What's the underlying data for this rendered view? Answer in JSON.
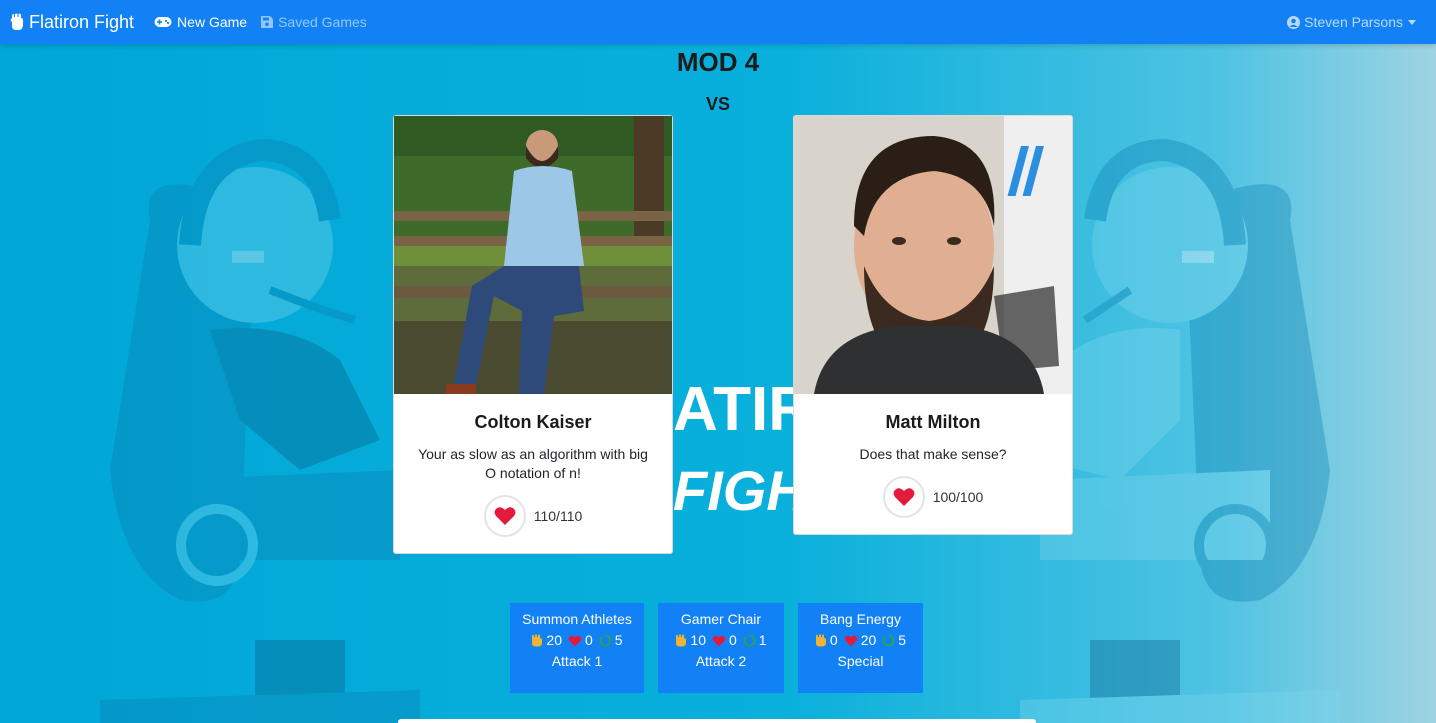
{
  "navbar": {
    "brand": "Flatiron Fight",
    "new_game": "New Game",
    "saved_games": "Saved Games",
    "user": "Steven Parsons"
  },
  "title": "MOD 4",
  "vs": "VS",
  "background_text": [
    "ATIR",
    "FIGHTE"
  ],
  "players": [
    {
      "name": "Colton Kaiser",
      "quote": "Your as slow as an algorithm with big O notation of n!",
      "hp": "110/110"
    },
    {
      "name": "Matt Milton",
      "quote": "Does that make sense?",
      "hp": "100/100"
    }
  ],
  "moves": [
    {
      "name": "Summon Athletes",
      "attack": "20",
      "heal": "0",
      "cooldown": "5",
      "type": "Attack 1"
    },
    {
      "name": "Gamer Chair",
      "attack": "10",
      "heal": "0",
      "cooldown": "1",
      "type": "Attack 2"
    },
    {
      "name": "Bang Energy",
      "attack": "0",
      "heal": "20",
      "cooldown": "5",
      "type": "Special"
    }
  ],
  "colors": {
    "navbar": "#1181f5",
    "heart": "#e21b3c",
    "cooldown": "#28a745",
    "fist": "#f2b233"
  }
}
